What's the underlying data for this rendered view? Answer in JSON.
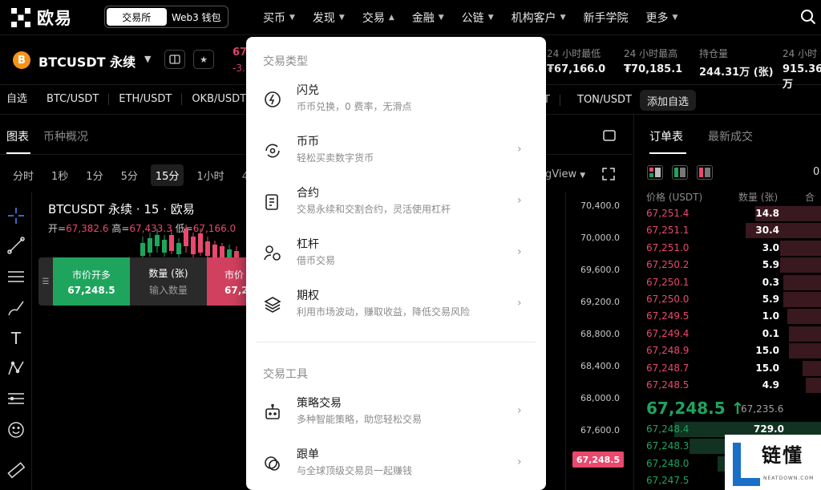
{
  "brand": {
    "name": "欧易"
  },
  "mode_switch": {
    "exchange": "交易所",
    "web3": "Web3 钱包"
  },
  "main_menu": [
    {
      "label": "买币",
      "chevron": "chevron-down"
    },
    {
      "label": "发现",
      "chevron": "chevron-down"
    },
    {
      "label": "交易",
      "chevron": "chevron-up"
    },
    {
      "label": "金融",
      "chevron": "chevron-down"
    },
    {
      "label": "公链",
      "chevron": "chevron-down"
    },
    {
      "label": "机构客户",
      "chevron": "chevron-down"
    },
    {
      "label": "新手学院",
      "chevron": ""
    },
    {
      "label": "更多",
      "chevron": "chevron-down"
    }
  ],
  "instrument": {
    "coin_icon": "B",
    "symbol": "BTCUSDT 永续",
    "price_partial": "67",
    "change_partial": "-3.",
    "stats": [
      {
        "label": "24 小时最低",
        "value": "₮67,166.0"
      },
      {
        "label": "24 小时最高",
        "value": "₮70,185.1"
      },
      {
        "label": "持仓量",
        "value": "244.31万 (张)"
      },
      {
        "label": "24 小时",
        "value": "915.36万"
      }
    ]
  },
  "favorites": {
    "label": "自选",
    "items": [
      "BTC/USDT",
      "ETH/USDT",
      "OKB/USDT"
    ],
    "partial": "T",
    "last": "TON/USDT",
    "add": "添加自选"
  },
  "chart_panel": {
    "tab_chart": "图表",
    "tab_overview": "币种概况",
    "intervals": [
      "分时",
      "1秒",
      "1分",
      "5分",
      "15分",
      "1小时",
      "4小"
    ],
    "active_interval": "15分",
    "view_partial": "gView",
    "title": "BTCUSDT 永续 · 15 · 欧易",
    "ohlc": {
      "open_label": "开=",
      "open": "67,382.6",
      "high_label": "高=",
      "high": "67,433.3",
      "low_label": "低=",
      "low": "67,166.0"
    },
    "axis_labels": [
      "70,400.0",
      "70,000.0",
      "69,600.0",
      "69,200.0",
      "68,800.0",
      "68,400.0",
      "68,000.0",
      "67,600.0"
    ],
    "last_price": "67,248.5"
  },
  "quick_order": {
    "buy_label": "市价开多",
    "buy_price": "67,248.5",
    "qty_label": "数量 (张)",
    "qty_placeholder": "输入数量",
    "sell_label": "市价",
    "sell_price": "67,2"
  },
  "order_book": {
    "tab_book": "订单表",
    "tab_trades": "最新成交",
    "zero_partial": "0",
    "head_price": "价格 (USDT)",
    "head_qty": "数量 (张)",
    "head_total": "合计",
    "asks": [
      {
        "price": "67,251.4",
        "qty": "14.8",
        "depth": 0.35
      },
      {
        "price": "67,251.1",
        "qty": "30.4",
        "depth": 0.4
      },
      {
        "price": "67,251.0",
        "qty": "3.0",
        "depth": 0.22
      },
      {
        "price": "67,250.2",
        "qty": "5.9",
        "depth": 0.22
      },
      {
        "price": "67,250.1",
        "qty": "0.3",
        "depth": 0.2
      },
      {
        "price": "67,250.0",
        "qty": "5.9",
        "depth": 0.2
      },
      {
        "price": "67,249.5",
        "qty": "1.0",
        "depth": 0.18
      },
      {
        "price": "67,249.4",
        "qty": "0.1",
        "depth": 0.17
      },
      {
        "price": "67,248.9",
        "qty": "15.0",
        "depth": 0.17
      },
      {
        "price": "67,248.7",
        "qty": "15.0",
        "depth": 0.1
      },
      {
        "price": "67,248.5",
        "qty": "4.9",
        "depth": 0.08
      }
    ],
    "mid_price": "67,248.5 ↑",
    "mid_ref": "67,235.6",
    "bids": [
      {
        "price": "67,248.4",
        "qty": "729.0",
        "depth": 0.78
      },
      {
        "price": "67,248.3",
        "qty": "",
        "depth": 0.7
      },
      {
        "price": "67,248.0",
        "qty": "",
        "depth": 0.55
      },
      {
        "price": "67,247.5",
        "qty": "",
        "depth": 0.45
      }
    ]
  },
  "dropdown": {
    "section_trade_types": "交易类型",
    "section_tools": "交易工具",
    "items": [
      {
        "icon": "flash-swap-icon",
        "title": "闪兑",
        "desc": "币币兑换，0 费率，无滑点",
        "arrow": ""
      },
      {
        "icon": "spot-icon",
        "title": "币币",
        "desc": "轻松买卖数字货币",
        "arrow": "›"
      },
      {
        "icon": "contract-icon",
        "title": "合约",
        "desc": "交易永续和交割合约，灵活使用杠杆",
        "arrow": "›"
      },
      {
        "icon": "margin-icon",
        "title": "杠杆",
        "desc": "借币交易",
        "arrow": "›"
      },
      {
        "icon": "options-icon",
        "title": "期权",
        "desc": "利用市场波动，赚取收益，降低交易风险",
        "arrow": "›"
      }
    ],
    "tools": [
      {
        "icon": "bot-icon",
        "title": "策略交易",
        "desc": "多种智能策略，助您轻松交易",
        "arrow": "›"
      },
      {
        "icon": "copy-trade-icon",
        "title": "跟单",
        "desc": "与全球顶级交易员一起赚钱",
        "arrow": "›"
      }
    ]
  },
  "watermark": {
    "text": "链懂",
    "sub": "NEATDOWN.COM"
  },
  "colors": {
    "up": "#1fa45e",
    "down": "#e8496d",
    "ask_bar": "#3a1820",
    "bid_bar": "#123322"
  }
}
